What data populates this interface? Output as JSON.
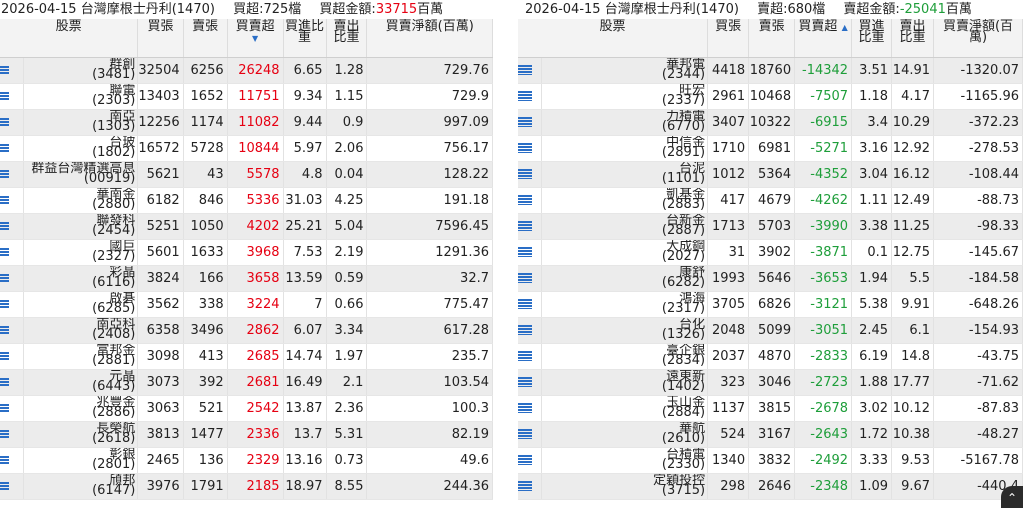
{
  "buy": {
    "date": "2026-04-15",
    "broker": "台灣摩根士丹利(1470)",
    "count_label": "買超:725檔",
    "amount_label": "買超金額:",
    "amount_value": "33715",
    "amount_unit": "百萬",
    "headers": {
      "stock": "股票",
      "buy": "買張",
      "sell": "賣張",
      "net": "買賣超",
      "buy_ratio": "買進比重",
      "sell_ratio": "賣出比重",
      "net_amount": "買賣淨額(百萬)"
    },
    "rows": [
      {
        "name": "群創",
        "code": "(3481)",
        "buy": "32504",
        "sell": "6256",
        "net": "26248",
        "br": "6.65",
        "sr": "1.28",
        "amt": "729.76"
      },
      {
        "name": "聯電",
        "code": "(2303)",
        "buy": "13403",
        "sell": "1652",
        "net": "11751",
        "br": "9.34",
        "sr": "1.15",
        "amt": "729.9"
      },
      {
        "name": "南亞",
        "code": "(1303)",
        "buy": "12256",
        "sell": "1174",
        "net": "11082",
        "br": "9.44",
        "sr": "0.9",
        "amt": "997.09"
      },
      {
        "name": "台玻",
        "code": "(1802)",
        "buy": "16572",
        "sell": "5728",
        "net": "10844",
        "br": "5.97",
        "sr": "2.06",
        "amt": "756.17"
      },
      {
        "name": "群益台灣精選高息",
        "code": "(00919)",
        "buy": "5621",
        "sell": "43",
        "net": "5578",
        "br": "4.8",
        "sr": "0.04",
        "amt": "128.22"
      },
      {
        "name": "華南金",
        "code": "(2880)",
        "buy": "6182",
        "sell": "846",
        "net": "5336",
        "br": "31.03",
        "sr": "4.25",
        "amt": "191.18"
      },
      {
        "name": "聯發科",
        "code": "(2454)",
        "buy": "5251",
        "sell": "1050",
        "net": "4202",
        "br": "25.21",
        "sr": "5.04",
        "amt": "7596.45"
      },
      {
        "name": "國巨",
        "code": "(2327)",
        "buy": "5601",
        "sell": "1633",
        "net": "3968",
        "br": "7.53",
        "sr": "2.19",
        "amt": "1291.36"
      },
      {
        "name": "彩晶",
        "code": "(6116)",
        "buy": "3824",
        "sell": "166",
        "net": "3658",
        "br": "13.59",
        "sr": "0.59",
        "amt": "32.7"
      },
      {
        "name": "啟碁",
        "code": "(6285)",
        "buy": "3562",
        "sell": "338",
        "net": "3224",
        "br": "7",
        "sr": "0.66",
        "amt": "775.47"
      },
      {
        "name": "南亞科",
        "code": "(2408)",
        "buy": "6358",
        "sell": "3496",
        "net": "2862",
        "br": "6.07",
        "sr": "3.34",
        "amt": "617.28"
      },
      {
        "name": "富邦金",
        "code": "(2881)",
        "buy": "3098",
        "sell": "413",
        "net": "2685",
        "br": "14.74",
        "sr": "1.97",
        "amt": "235.7"
      },
      {
        "name": "元晶",
        "code": "(6443)",
        "buy": "3073",
        "sell": "392",
        "net": "2681",
        "br": "16.49",
        "sr": "2.1",
        "amt": "103.54"
      },
      {
        "name": "兆豐金",
        "code": "(2886)",
        "buy": "3063",
        "sell": "521",
        "net": "2542",
        "br": "13.87",
        "sr": "2.36",
        "amt": "100.3"
      },
      {
        "name": "長榮航",
        "code": "(2618)",
        "buy": "3813",
        "sell": "1477",
        "net": "2336",
        "br": "13.7",
        "sr": "5.31",
        "amt": "82.19"
      },
      {
        "name": "彰銀",
        "code": "(2801)",
        "buy": "2465",
        "sell": "136",
        "net": "2329",
        "br": "13.16",
        "sr": "0.73",
        "amt": "49.6"
      },
      {
        "name": "頎邦",
        "code": "(6147)",
        "buy": "3976",
        "sell": "1791",
        "net": "2185",
        "br": "18.97",
        "sr": "8.55",
        "amt": "244.36"
      }
    ]
  },
  "sell": {
    "date": "2026-04-15",
    "broker": "台灣摩根士丹利(1470)",
    "count_label": "賣超:680檔",
    "amount_label": "賣超金額:",
    "amount_value": "-25041",
    "amount_unit": "百萬",
    "headers": {
      "stock": "股票",
      "buy": "買張",
      "sell": "賣張",
      "net": "買賣超",
      "buy_ratio": "買進比重",
      "sell_ratio": "賣出比重",
      "net_amount": "買賣淨額(百萬)"
    },
    "rows": [
      {
        "name": "華邦電",
        "code": "(2344)",
        "buy": "4418",
        "sell": "18760",
        "net": "-14342",
        "br": "3.51",
        "sr": "14.91",
        "amt": "-1320.07"
      },
      {
        "name": "旺宏",
        "code": "(2337)",
        "buy": "2961",
        "sell": "10468",
        "net": "-7507",
        "br": "1.18",
        "sr": "4.17",
        "amt": "-1165.96"
      },
      {
        "name": "力積電",
        "code": "(6770)",
        "buy": "3407",
        "sell": "10322",
        "net": "-6915",
        "br": "3.4",
        "sr": "10.29",
        "amt": "-372.23"
      },
      {
        "name": "中信金",
        "code": "(2891)",
        "buy": "1710",
        "sell": "6981",
        "net": "-5271",
        "br": "3.16",
        "sr": "12.92",
        "amt": "-278.53"
      },
      {
        "name": "台泥",
        "code": "(1101)",
        "buy": "1012",
        "sell": "5364",
        "net": "-4352",
        "br": "3.04",
        "sr": "16.12",
        "amt": "-108.44"
      },
      {
        "name": "凱基金",
        "code": "(2883)",
        "buy": "417",
        "sell": "4679",
        "net": "-4262",
        "br": "1.11",
        "sr": "12.49",
        "amt": "-88.73"
      },
      {
        "name": "台新金",
        "code": "(2887)",
        "buy": "1713",
        "sell": "5703",
        "net": "-3990",
        "br": "3.38",
        "sr": "11.25",
        "amt": "-98.33"
      },
      {
        "name": "大成鋼",
        "code": "(2027)",
        "buy": "31",
        "sell": "3902",
        "net": "-3871",
        "br": "0.1",
        "sr": "12.75",
        "amt": "-145.67"
      },
      {
        "name": "康舒",
        "code": "(6282)",
        "buy": "1993",
        "sell": "5646",
        "net": "-3653",
        "br": "1.94",
        "sr": "5.5",
        "amt": "-184.58"
      },
      {
        "name": "鴻海",
        "code": "(2317)",
        "buy": "3705",
        "sell": "6826",
        "net": "-3121",
        "br": "5.38",
        "sr": "9.91",
        "amt": "-648.26"
      },
      {
        "name": "台化",
        "code": "(1326)",
        "buy": "2048",
        "sell": "5099",
        "net": "-3051",
        "br": "2.45",
        "sr": "6.1",
        "amt": "-154.93"
      },
      {
        "name": "臺企銀",
        "code": "(2834)",
        "buy": "2037",
        "sell": "4870",
        "net": "-2833",
        "br": "6.19",
        "sr": "14.8",
        "amt": "-43.75"
      },
      {
        "name": "遠東新",
        "code": "(1402)",
        "buy": "323",
        "sell": "3046",
        "net": "-2723",
        "br": "1.88",
        "sr": "17.77",
        "amt": "-71.62"
      },
      {
        "name": "玉山金",
        "code": "(2884)",
        "buy": "1137",
        "sell": "3815",
        "net": "-2678",
        "br": "3.02",
        "sr": "10.12",
        "amt": "-87.83"
      },
      {
        "name": "華航",
        "code": "(2610)",
        "buy": "524",
        "sell": "3167",
        "net": "-2643",
        "br": "1.72",
        "sr": "10.38",
        "amt": "-48.27"
      },
      {
        "name": "台積電",
        "code": "(2330)",
        "buy": "1340",
        "sell": "3832",
        "net": "-2492",
        "br": "3.33",
        "sr": "9.53",
        "amt": "-5167.78"
      },
      {
        "name": "定穎投控",
        "code": "(3715)",
        "buy": "298",
        "sell": "2646",
        "net": "-2348",
        "br": "1.09",
        "sr": "9.67",
        "amt": "-440.4"
      }
    ]
  },
  "icons": {
    "row_menu": "menu-icon",
    "sort_desc": "sort-down-icon",
    "sort_asc": "sort-up-icon",
    "scroll_top": "chevron-up-icon"
  },
  "colors": {
    "positive": "#e60012",
    "negative": "#1e9e3a",
    "accent": "#2a6ec6"
  }
}
